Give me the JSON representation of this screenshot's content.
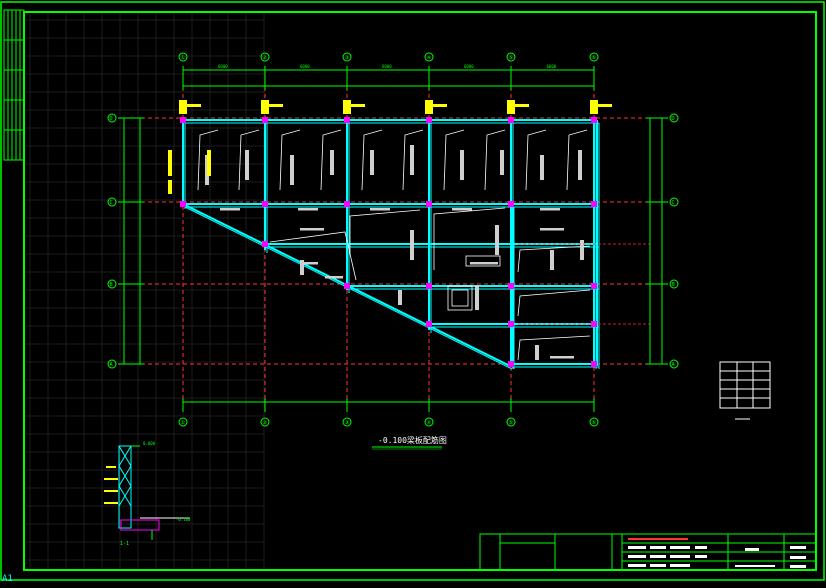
{
  "drawing": {
    "title": "-0.100梁板配筋图",
    "corner_mark": "A1",
    "grid_columns": [
      "①",
      "②",
      "③",
      "④",
      "⑤",
      "⑥"
    ],
    "grid_rows": [
      "D",
      "C",
      "B",
      "A"
    ],
    "dim_labels": [
      "6000",
      "6000",
      "6000",
      "6000",
      "6000"
    ],
    "section_label": "1-1",
    "elev_label_top": "0.000",
    "elev_label_bottom": "-0.100",
    "colors": {
      "frame": "#00ff00",
      "beam": "#00ffff",
      "grid": "#ff0000",
      "rebar": "#ffffff",
      "tag": "#ffff00",
      "column": "#ff00ff"
    }
  }
}
